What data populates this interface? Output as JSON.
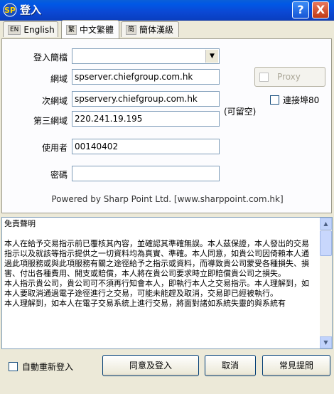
{
  "window": {
    "title": "登入",
    "help_icon": "?",
    "close_icon": "X"
  },
  "tabs": [
    {
      "tag": "EN",
      "label": "English"
    },
    {
      "tag": "繁",
      "label": "中文繁體"
    },
    {
      "tag": "简",
      "label": "簡体漢級"
    }
  ],
  "form": {
    "login_type_label": "登入簡檔",
    "login_type_value": "",
    "domain_label": "網域",
    "domain_value": "spserver.chiefgroup.com.hk",
    "secondary_domain_label": "次網域",
    "secondary_domain_value": "spservery.chiefgroup.com.hk",
    "third_domain_label": "第三網域",
    "third_domain_value": "220.241.19.195",
    "optional_note": "(可留空)",
    "user_label": "使用者",
    "user_value": "00140402",
    "password_label": "密碼",
    "password_value": "",
    "proxy_label": "Proxy",
    "port_label": "連接埠80"
  },
  "powered_by": "Powered by Sharp Point Ltd. [www.sharppoint.com.hk]",
  "disclaimer": {
    "title": "免責聲明",
    "paragraphs": [
      "本人在給予交易指示前已覆核其內容，並確認其準確無誤。本人茲保證，本人發出的交易指示以及就該等指示提供之一切資料均為真實、準確。本人同意，如貴公司因倚賴本人通過此項服務或與此項服務有關之途徑給予之指示或資料，而導致貴公司蒙受各種損失、損害、付出各種費用、開支或賠償，本人將在貴公司要求時立即賠償貴公司之損失。",
      "本人指示貴公司，貴公司可不須再行知會本人，即執行本人之交易指示。本人理解到，如本人要取消通過電子途徑進行之交易，可能未能趕及取消，交易即已經被執行。",
      "本人理解到，如本人在電子交易系統上進行交易，將面對諸如系統失靈的與系統有"
    ]
  },
  "bottom": {
    "auto_relogin_label": "自動重新登入",
    "agree_button": "同意及登入",
    "cancel_button": "取消",
    "faq_button": "常見提問"
  }
}
